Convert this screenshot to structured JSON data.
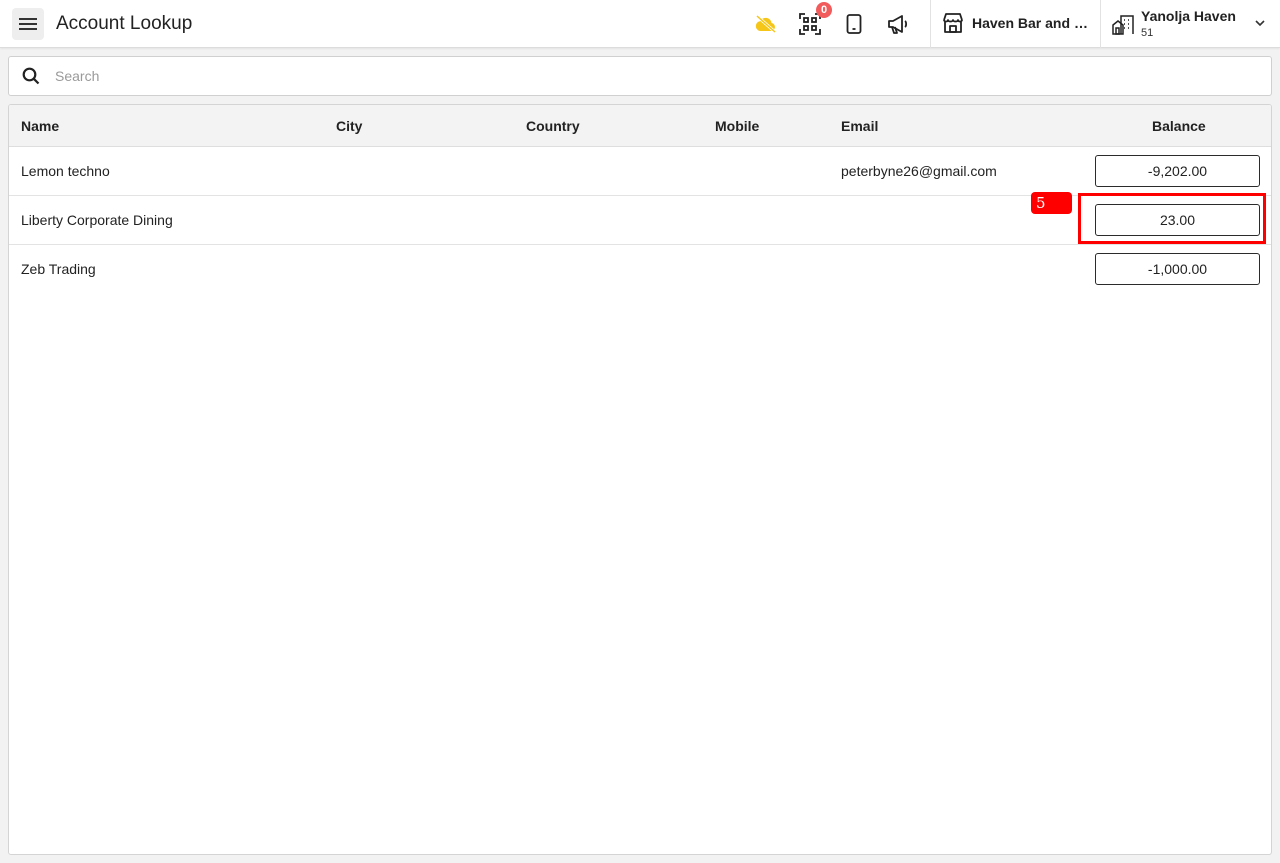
{
  "header": {
    "title": "Account Lookup",
    "notification_count": "0",
    "icons": [
      "menu-icon",
      "cloud-off-icon",
      "qr-scan-icon",
      "tablet-icon",
      "megaphone-icon"
    ],
    "cloud_icon_color": "#f5c518",
    "badge_color": "#f15b5b",
    "outlet": {
      "label": "Haven Bar and R...",
      "icon": "storefront-icon"
    },
    "property": {
      "name": "Yanolja Haven",
      "number": "51",
      "icon": "building-icon"
    }
  },
  "search": {
    "placeholder": "Search",
    "value": ""
  },
  "table": {
    "columns": {
      "name": "Name",
      "city": "City",
      "country": "Country",
      "mobile": "Mobile",
      "email": "Email",
      "balance": "Balance"
    },
    "rows": [
      {
        "name": "Lemon techno",
        "city": "",
        "country": "",
        "mobile": "",
        "email": "peterbyne26@gmail.com",
        "balance": "-9,202.00"
      },
      {
        "name": "Liberty Corporate Dining",
        "city": "",
        "country": "",
        "mobile": "",
        "email": "",
        "balance": "23.00"
      },
      {
        "name": "Zeb Trading",
        "city": "",
        "country": "",
        "mobile": "",
        "email": "",
        "balance": "-1,000.00"
      }
    ]
  },
  "annotation": {
    "label": "5",
    "color": "#ff0000"
  }
}
